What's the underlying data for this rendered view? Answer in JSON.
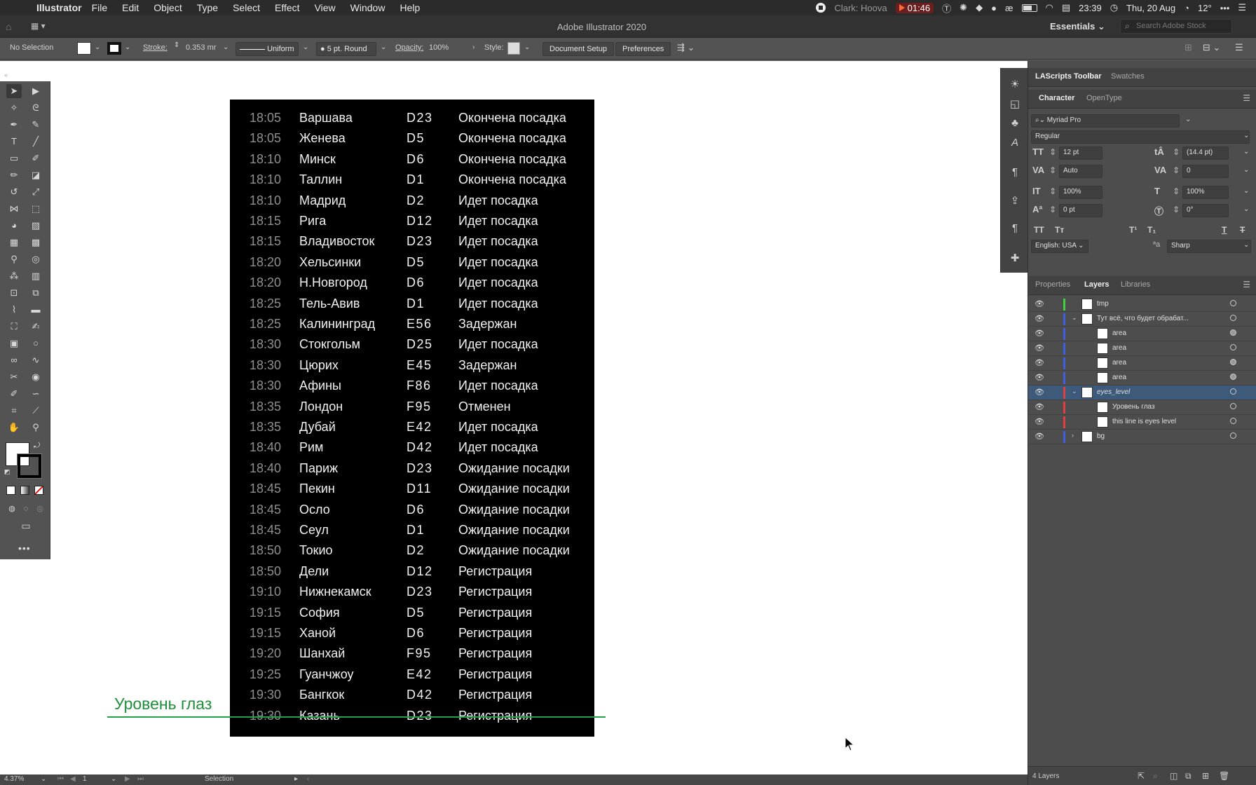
{
  "menubar": {
    "app_name": "Illustrator",
    "items": [
      "File",
      "Edit",
      "Object",
      "Type",
      "Select",
      "Effect",
      "View",
      "Window",
      "Help"
    ],
    "user_text": "Clark: Hoova",
    "timer": "01:46",
    "clock": "23:39",
    "date": "Thu, 20 Aug",
    "temperature": "12°"
  },
  "titlebar": {
    "title": "Adobe Illustrator 2020",
    "workspace": "Essentials",
    "search_placeholder": "Search Adobe Stock"
  },
  "control": {
    "selection": "No Selection",
    "stroke_label": "Stroke:",
    "stroke_value": "0.353 mr",
    "profile": "Uniform",
    "brush": "5 pt. Round",
    "opacity_label": "Opacity:",
    "opacity_value": "100%",
    "style_label": "Style:",
    "document_setup": "Document Setup",
    "preferences": "Preferences"
  },
  "artboard": {
    "flights": [
      {
        "time": "18:05",
        "city": "Варшава",
        "gate": "D23",
        "status": "Окончена посадка"
      },
      {
        "time": "18:05",
        "city": "Женева",
        "gate": "D5",
        "status": "Окончена посадка"
      },
      {
        "time": "18:10",
        "city": "Минск",
        "gate": "D6",
        "status": "Окончена посадка"
      },
      {
        "time": "18:10",
        "city": "Таллин",
        "gate": "D1",
        "status": "Окончена посадка"
      },
      {
        "time": "18:10",
        "city": "Мадрид",
        "gate": "D2",
        "status": "Идет посадка"
      },
      {
        "time": "18:15",
        "city": "Рига",
        "gate": "D12",
        "status": "Идет посадка"
      },
      {
        "time": "18:15",
        "city": "Владивосток",
        "gate": "D23",
        "status": "Идет посадка"
      },
      {
        "time": "18:20",
        "city": "Хельсинки",
        "gate": "D5",
        "status": "Идет посадка"
      },
      {
        "time": "18:20",
        "city": "Н.Новгород",
        "gate": "D6",
        "status": "Идет посадка"
      },
      {
        "time": "18:25",
        "city": "Тель-Авив",
        "gate": "D1",
        "status": "Идет посадка"
      },
      {
        "time": "18:25",
        "city": "Калининград",
        "gate": "E56",
        "status": "Задержан"
      },
      {
        "time": "18:30",
        "city": "Стокгольм",
        "gate": "D25",
        "status": "Идет посадка"
      },
      {
        "time": "18:30",
        "city": "Цюрих",
        "gate": "E45",
        "status": "Задержан"
      },
      {
        "time": "18:30",
        "city": "Афины",
        "gate": "F86",
        "status": "Идет посадка"
      },
      {
        "time": "18:35",
        "city": "Лондон",
        "gate": "F95",
        "status": "Отменен"
      },
      {
        "time": "18:35",
        "city": "Дубай",
        "gate": "E42",
        "status": "Идет посадка"
      },
      {
        "time": "18:40",
        "city": "Рим",
        "gate": "D42",
        "status": "Идет посадка"
      },
      {
        "time": "18:40",
        "city": "Париж",
        "gate": "D23",
        "status": "Ожидание посадки"
      },
      {
        "time": "18:45",
        "city": "Пекин",
        "gate": "D11",
        "status": "Ожидание посадки"
      },
      {
        "time": "18:45",
        "city": "Осло",
        "gate": "D6",
        "status": "Ожидание посадки"
      },
      {
        "time": "18:45",
        "city": "Сеул",
        "gate": "D1",
        "status": "Ожидание посадки"
      },
      {
        "time": "18:50",
        "city": "Токио",
        "gate": "D2",
        "status": "Ожидание посадки"
      },
      {
        "time": "18:50",
        "city": "Дели",
        "gate": "D12",
        "status": "Регистрация"
      },
      {
        "time": "19:10",
        "city": "Нижнекамск",
        "gate": "D23",
        "status": "Регистрация"
      },
      {
        "time": "19:15",
        "city": "София",
        "gate": "D5",
        "status": "Регистрация"
      },
      {
        "time": "19:15",
        "city": "Ханой",
        "gate": "D6",
        "status": "Регистрация"
      },
      {
        "time": "19:20",
        "city": "Шанхай",
        "gate": "F95",
        "status": "Регистрация"
      },
      {
        "time": "19:25",
        "city": "Гуанчжоу",
        "gate": "E42",
        "status": "Регистрация"
      },
      {
        "time": "19:30",
        "city": "Бангкок",
        "gate": "D42",
        "status": "Регистрация"
      },
      {
        "time": "19:30",
        "city": "Казань",
        "gate": "D23",
        "status": "Регистрация"
      }
    ],
    "eye_level_label": "Уровень глаз"
  },
  "status": {
    "zoom": "4.37%",
    "artboard_num": "1",
    "tool": "Selection"
  },
  "top_panel": {
    "tabs": [
      "LAScripts Toolbar",
      "Swatches"
    ]
  },
  "character": {
    "tabs": [
      "Character",
      "OpenType"
    ],
    "font_family": "Myriad Pro",
    "font_style": "Regular",
    "size": "12 pt",
    "leading": "(14.4 pt)",
    "kerning": "Auto",
    "tracking": "0",
    "vscale": "100%",
    "hscale": "100%",
    "baseline": "0 pt",
    "rotation": "0°",
    "language": "English: USA",
    "antialias": "Sharp"
  },
  "layers_panel": {
    "tabs": [
      "Properties",
      "Layers",
      "Libraries"
    ],
    "rows": [
      {
        "name": "tmp",
        "indent": 0,
        "color": "#3fd13f",
        "expand": "",
        "selected": false,
        "filled": false,
        "italic": false
      },
      {
        "name": "Тут всё, что будет обрабат...",
        "indent": 0,
        "color": "#3f5fe0",
        "expand": "v",
        "selected": false,
        "filled": false,
        "italic": false
      },
      {
        "name": "area",
        "indent": 1,
        "color": "#3f5fe0",
        "expand": "",
        "selected": false,
        "filled": true,
        "italic": false
      },
      {
        "name": "area",
        "indent": 1,
        "color": "#3f5fe0",
        "expand": "",
        "selected": false,
        "filled": false,
        "italic": false
      },
      {
        "name": "area",
        "indent": 1,
        "color": "#3f5fe0",
        "expand": "",
        "selected": false,
        "filled": true,
        "italic": false
      },
      {
        "name": "area",
        "indent": 1,
        "color": "#3f5fe0",
        "expand": "",
        "selected": false,
        "filled": true,
        "italic": false
      },
      {
        "name": "eyes_level",
        "indent": 0,
        "color": "#e04040",
        "expand": "v",
        "selected": true,
        "filled": false,
        "italic": true
      },
      {
        "name": "Уровень глаз",
        "indent": 1,
        "color": "#e04040",
        "expand": "",
        "selected": false,
        "filled": false,
        "italic": false
      },
      {
        "name": "this line is eyes level",
        "indent": 1,
        "color": "#e04040",
        "expand": "",
        "selected": false,
        "filled": false,
        "italic": false
      },
      {
        "name": "bg",
        "indent": 0,
        "color": "#3f5fe0",
        "expand": ">",
        "selected": false,
        "filled": false,
        "italic": false
      }
    ],
    "count": "4 Layers"
  },
  "colors": {
    "eye_level": "#22a04a",
    "board": "#000000",
    "layer_selected": "#3d5a7a"
  }
}
